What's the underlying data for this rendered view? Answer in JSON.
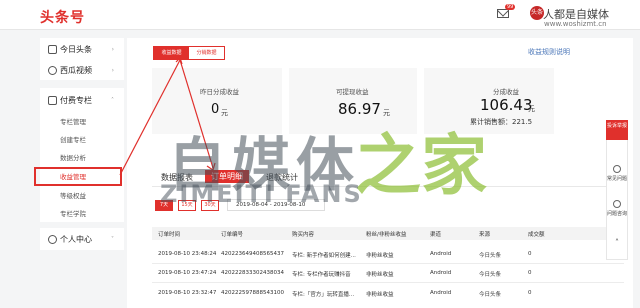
{
  "header": {
    "logo": "头条号",
    "mail_badge": "99",
    "avatar_text": "头条",
    "watermark_name": "人都是自媒体",
    "watermark_url": "www.woshizmt.cn"
  },
  "sidebar": {
    "group1": [
      {
        "label": "今日头条"
      },
      {
        "label": "西瓜视频"
      }
    ],
    "group2": {
      "label": "付费专栏",
      "items": [
        "专栏管理",
        "创建专栏",
        "数据分析",
        "收益管理",
        "等级权益",
        "专栏学院"
      ],
      "active_index": 3
    },
    "group3": {
      "label": "个人中心"
    }
  },
  "main": {
    "top_tabs": [
      "收益数据",
      "分销数据"
    ],
    "rule_link": "收益规则说明",
    "cards": [
      {
        "label": "昨日分成收益",
        "value": "0",
        "unit": "元"
      },
      {
        "label": "可提现收益",
        "value": "86.97",
        "unit": "元"
      },
      {
        "label": "分成收益",
        "value": "106.43",
        "unit": "元",
        "extra": "累计销售额：221.5"
      }
    ],
    "sub_tabs": [
      "数据报表",
      "订单明细",
      "退款统计"
    ],
    "range_buttons": [
      "7天",
      "15天",
      "30天"
    ],
    "date_range": "2019-08-04  -  2019-08-10",
    "table": {
      "headers": [
        "订单时间",
        "订单编号",
        "购买内容",
        "粉丝/非粉丝收益",
        "渠道",
        "来源",
        "成交额"
      ],
      "rows": [
        [
          "2019-08-10 23:48:24",
          "420223649408565437",
          "专栏: 新手作者如何创建...",
          "非粉丝收益",
          "Android",
          "今日头条",
          "0"
        ],
        [
          "2019-08-10 23:47:24",
          "420222833302438034",
          "专栏: 专栏作者玩赚抖音",
          "非粉丝收益",
          "Android",
          "今日头条",
          "0"
        ],
        [
          "2019-08-10 23:32:47",
          "420222597888543100",
          "专栏:「官方」玩转直播...",
          "非粉丝收益",
          "Android",
          "今日头条",
          "0"
        ]
      ]
    }
  },
  "right_rail": {
    "top": "投诉举报",
    "items": [
      "常见问题",
      "问题咨询"
    ]
  },
  "overlay": {
    "big_text": "自媒体",
    "green_char": "之家",
    "latin": "ZIMEITI FANS"
  },
  "colors": {
    "accent": "#e0302c",
    "link": "#4a76b8",
    "watermark_green": "#8cbe32"
  }
}
